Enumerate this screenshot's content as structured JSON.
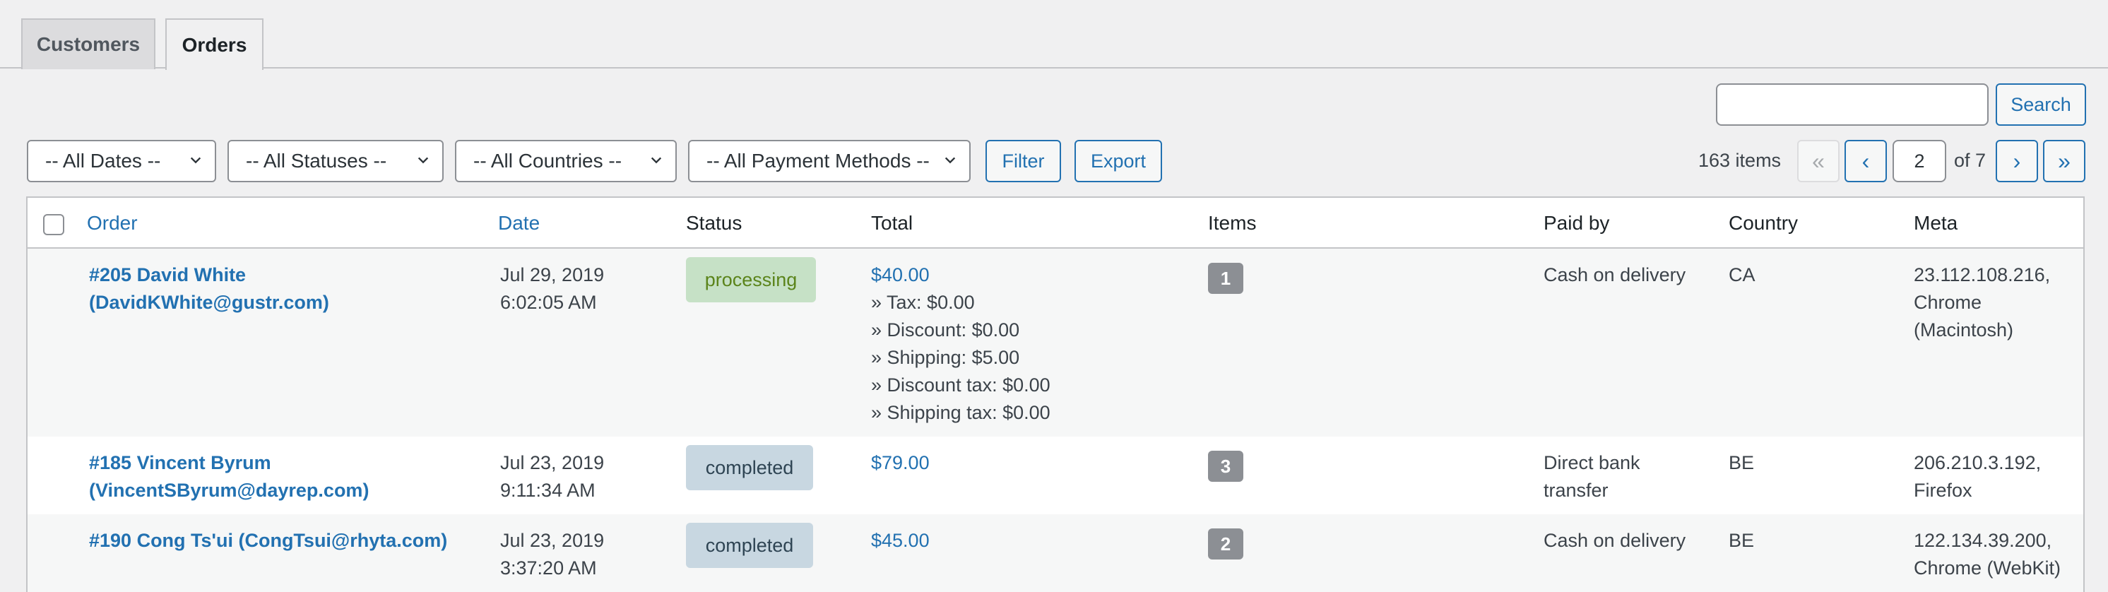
{
  "tabs": [
    {
      "label": "Customers",
      "active": false
    },
    {
      "label": "Orders",
      "active": true
    }
  ],
  "search": {
    "value": "",
    "placeholder": "",
    "button_label": "Search"
  },
  "filters": {
    "dates": "-- All Dates --",
    "statuses": "-- All Statuses --",
    "countries": "-- All Countries --",
    "payment_methods": "-- All Payment Methods --",
    "filter_label": "Filter",
    "export_label": "Export"
  },
  "pagination": {
    "items_count": "163 items",
    "first": "«",
    "prev": "‹",
    "current_page": "2",
    "total_pages": "of 7",
    "next": "›",
    "last": "»"
  },
  "table": {
    "columns": [
      "Order",
      "Date",
      "Status",
      "Total",
      "Items",
      "Paid by",
      "Country",
      "Meta"
    ],
    "rows": [
      {
        "order_line1": "#205 David White",
        "order_line2": "(DavidKWhite@gustr.com)",
        "date": "Jul 29, 2019",
        "time": "6:02:05 AM",
        "status": "processing",
        "total": "$40.00",
        "breakdown": [
          "» Tax: $0.00",
          "» Discount: $0.00",
          "» Shipping: $5.00",
          "» Discount tax: $0.00",
          "» Shipping tax: $0.00"
        ],
        "items": "1",
        "paid_by_line1": "Cash on delivery",
        "paid_by_line2": "",
        "country": "CA",
        "meta_line1": "23.112.108.216,",
        "meta_line2": "Chrome",
        "meta_line3": "(Macintosh)"
      },
      {
        "order_line1": "#185 Vincent Byrum",
        "order_line2": "(VincentSByrum@dayrep.com)",
        "date": "Jul 23, 2019",
        "time": "9:11:34 AM",
        "status": "completed",
        "total": "$79.00",
        "breakdown": [],
        "items": "3",
        "paid_by_line1": "Direct bank",
        "paid_by_line2": "transfer",
        "country": "BE",
        "meta_line1": "206.210.3.192,",
        "meta_line2": "Firefox",
        "meta_line3": ""
      },
      {
        "order_line1": "#190 Cong Ts'ui (CongTsui@rhyta.com)",
        "order_line2": "",
        "date": "Jul 23, 2019",
        "time": "3:37:20 AM",
        "status": "completed",
        "total": "$45.00",
        "breakdown": [],
        "items": "2",
        "paid_by_line1": "Cash on delivery",
        "paid_by_line2": "",
        "country": "BE",
        "meta_line1": "122.134.39.200,",
        "meta_line2": "Chrome (WebKit)",
        "meta_line3": ""
      }
    ]
  },
  "colors": {
    "link": "#2271b1",
    "processing_bg": "#c6e1c6",
    "processing_text": "#5b841b",
    "completed_bg": "#c8d7e1",
    "completed_text": "#2e4453"
  }
}
